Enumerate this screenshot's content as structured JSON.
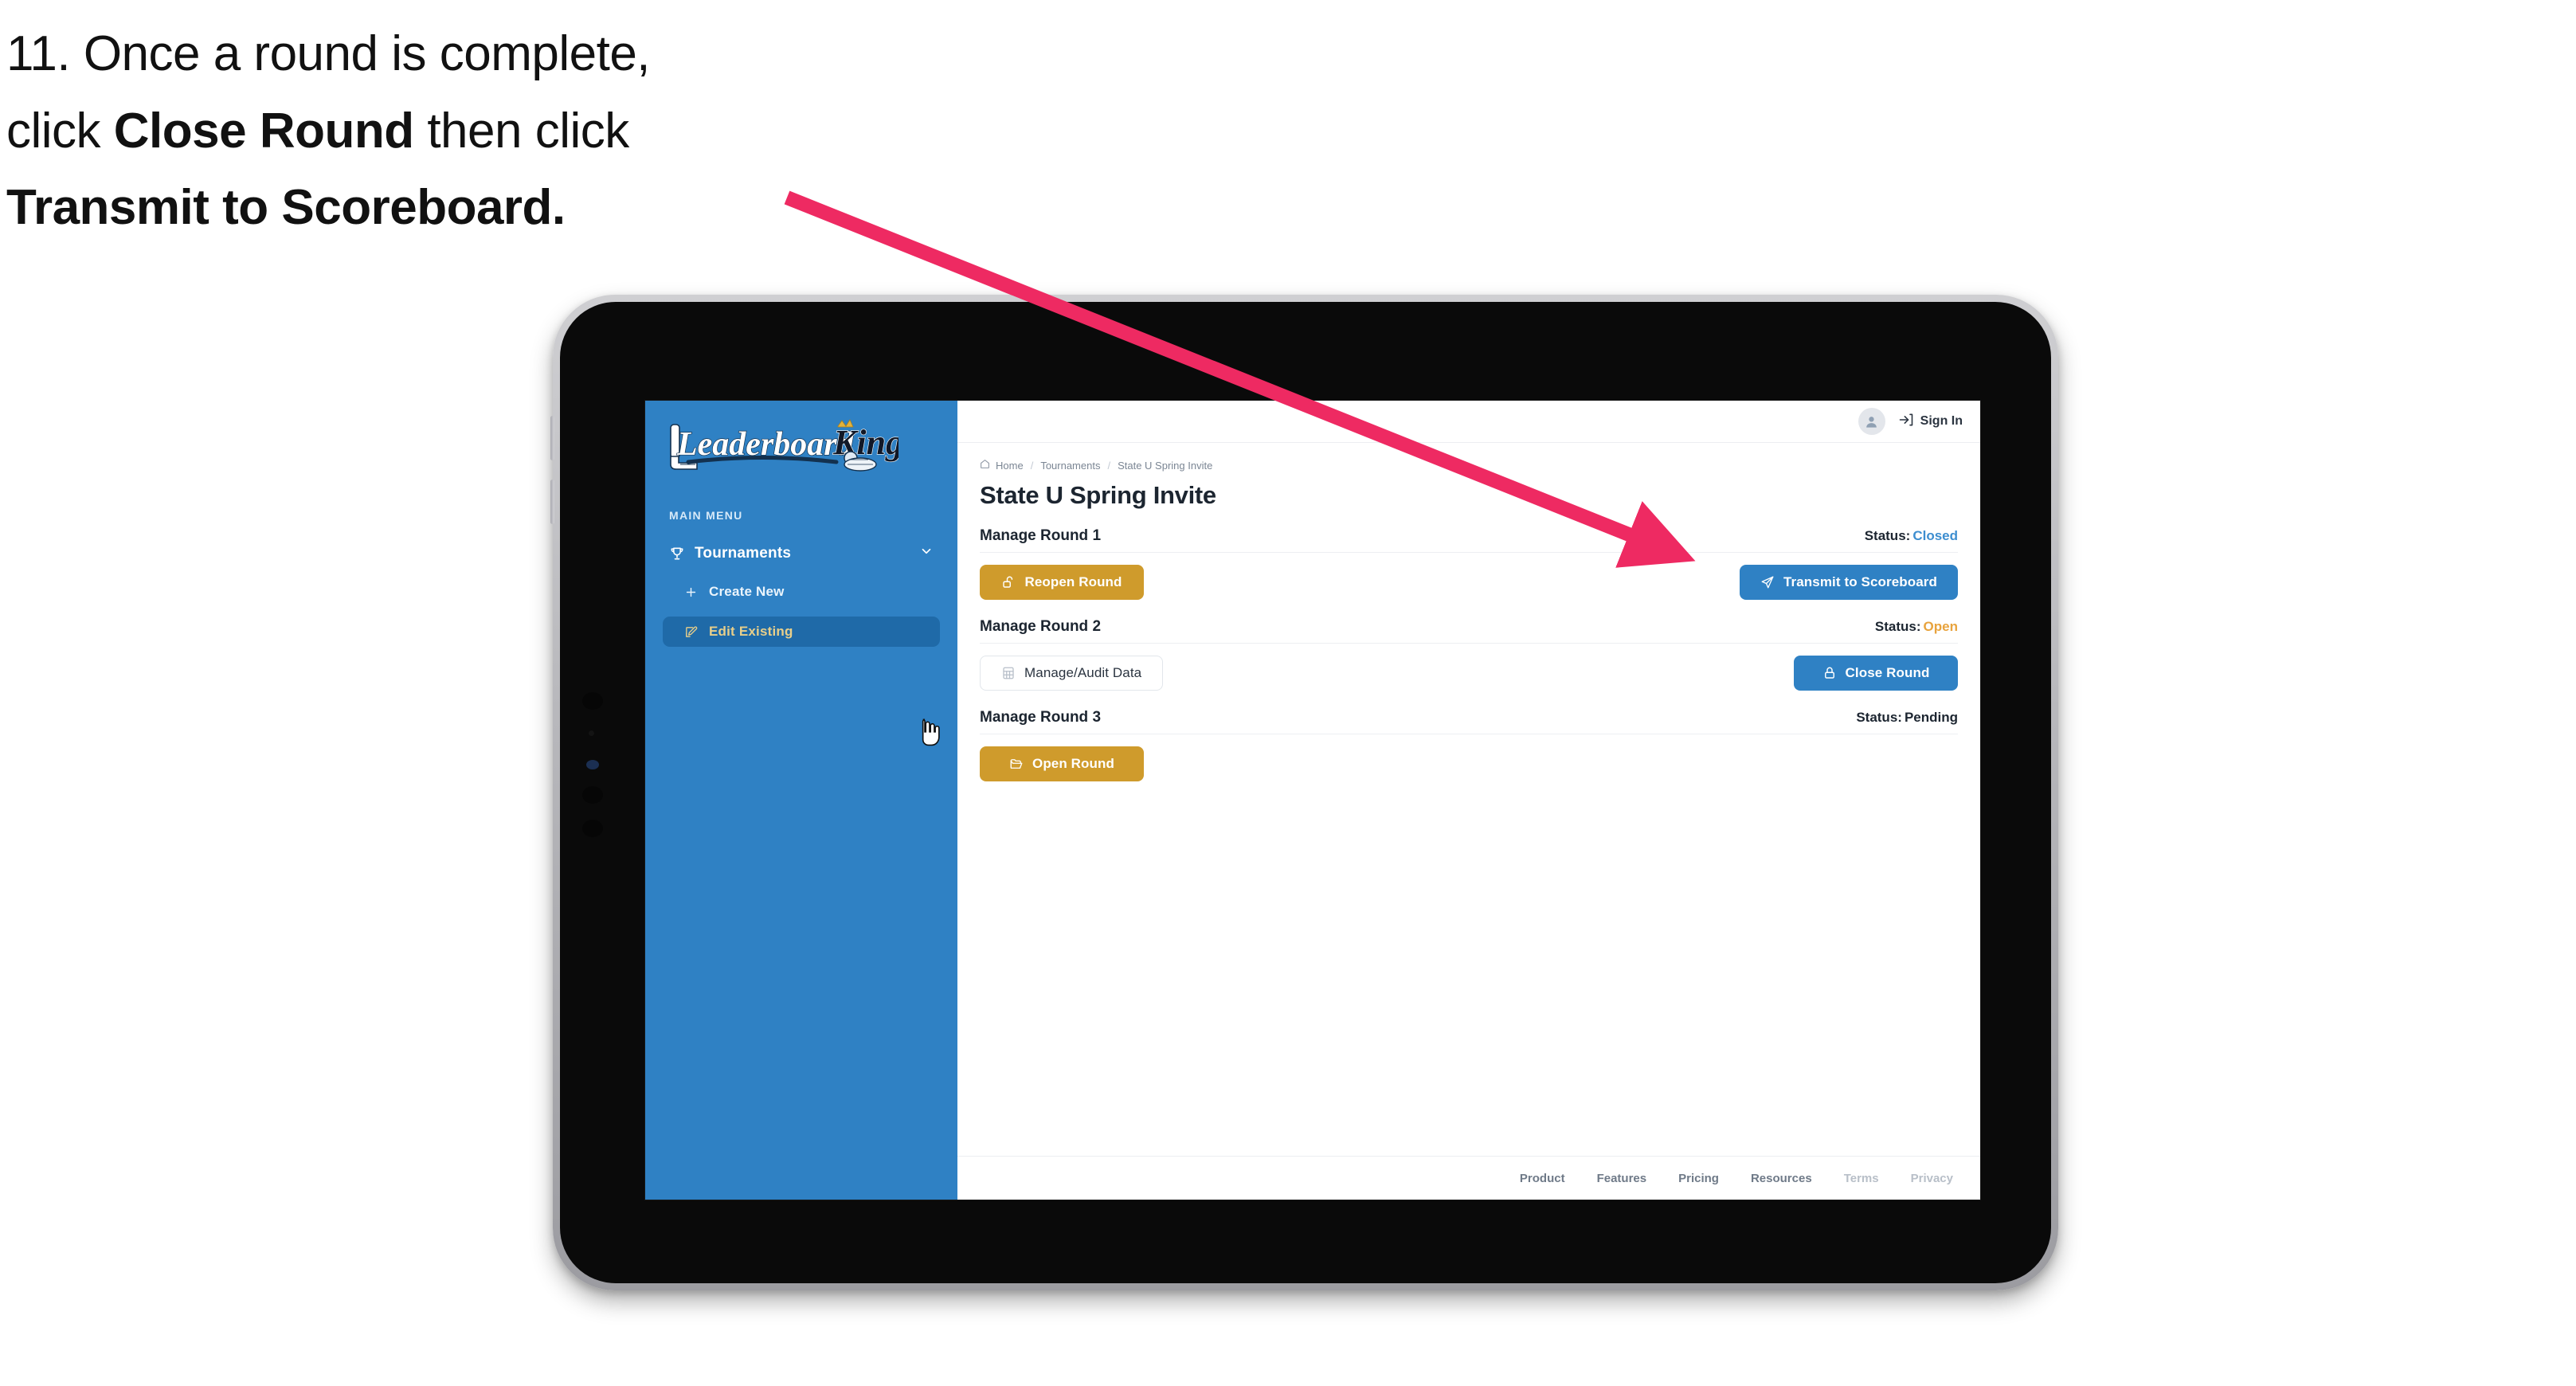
{
  "annotation": {
    "step_number": "11.",
    "line1_pre": "11. Once a round is complete,",
    "line2_pre": "click ",
    "line2_bold": "Close Round",
    "line2_post": " then click",
    "line3_bold": "Transmit to Scoreboard.",
    "arrow_color": "#ee2a62"
  },
  "app": {
    "brand": {
      "logo_word1": "Leaderboard",
      "logo_word2": "King",
      "sidebar_color": "#2f81c4"
    },
    "sidebar": {
      "section_label": "MAIN MENU",
      "group": {
        "label": "Tournaments",
        "icon": "trophy-icon",
        "chevron": "chevron-down-icon"
      },
      "items": [
        {
          "label": "Create New",
          "icon": "plus-icon",
          "active": false
        },
        {
          "label": "Edit Existing",
          "icon": "edit-square-icon",
          "active": true
        }
      ]
    },
    "topbar": {
      "avatar_icon": "user-avatar-icon",
      "signin_icon": "sign-in-icon",
      "signin_label": "Sign In"
    },
    "breadcrumb": {
      "home_icon": "home-icon",
      "items": [
        "Home",
        "Tournaments",
        "State U Spring Invite"
      ],
      "separator": "/"
    },
    "page_title": "State U Spring Invite",
    "rounds": [
      {
        "title": "Manage Round 1",
        "status_label": "Status:",
        "status_value": "Closed",
        "status_color": "#3d8ed0",
        "left_button": {
          "label": "Reopen Round",
          "icon": "unlock-icon",
          "style": "gold"
        },
        "right_button": {
          "label": "Transmit to Scoreboard",
          "icon": "send-plane-icon",
          "style": "blue"
        }
      },
      {
        "title": "Manage Round 2",
        "status_label": "Status:",
        "status_value": "Open",
        "status_color": "#e8a33d",
        "left_button": {
          "label": "Manage/Audit Data",
          "icon": "table-grid-icon",
          "style": "ghost"
        },
        "right_button": {
          "label": "Close Round",
          "icon": "lock-icon",
          "style": "blue"
        }
      },
      {
        "title": "Manage Round 3",
        "status_label": "Status:",
        "status_value": "Pending",
        "status_color": "#1c2530",
        "left_button": {
          "label": "Open Round",
          "icon": "folder-open-icon",
          "style": "gold"
        },
        "right_button": null
      }
    ],
    "footer": {
      "links": [
        {
          "label": "Product",
          "muted": false
        },
        {
          "label": "Features",
          "muted": false
        },
        {
          "label": "Pricing",
          "muted": false
        },
        {
          "label": "Resources",
          "muted": false
        },
        {
          "label": "Terms",
          "muted": true
        },
        {
          "label": "Privacy",
          "muted": true
        }
      ]
    }
  }
}
